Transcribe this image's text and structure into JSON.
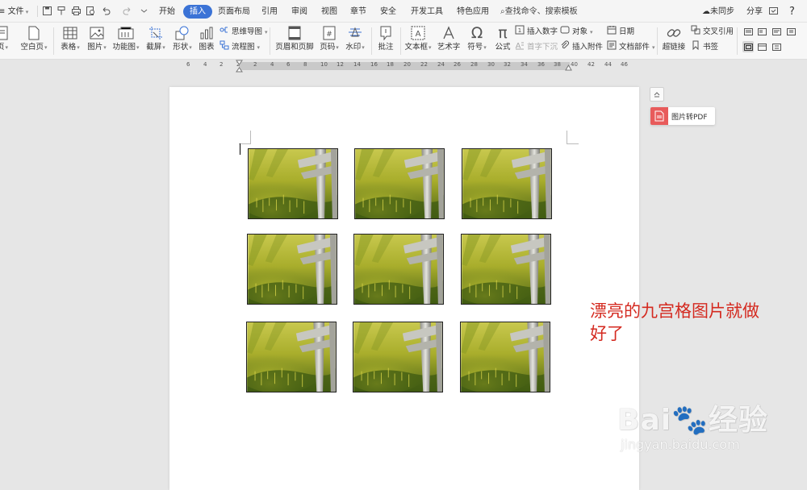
{
  "menubar": {
    "file_label": "文件",
    "tabs": [
      "开始",
      "插入",
      "页面布局",
      "引用",
      "审阅",
      "视图",
      "章节",
      "安全",
      "开发工具",
      "特色应用"
    ],
    "active_tab": "插入",
    "search_hint": "查找命令、搜索模板",
    "sync_status": "未同步",
    "share_label": "分享",
    "help_label": "?"
  },
  "ribbon": {
    "left_items": [
      {
        "label": "页",
        "caret": true,
        "icon": "page-icon"
      },
      {
        "label": "空白页",
        "caret": true,
        "icon": "blank-page-icon"
      },
      {
        "label": "表格",
        "caret": true,
        "icon": "table-icon"
      },
      {
        "label": "图片",
        "caret": true,
        "icon": "picture-icon"
      },
      {
        "label": "功能图",
        "caret": true,
        "icon": "function-chart-icon"
      },
      {
        "label": "截屏",
        "caret": true,
        "icon": "screenshot-icon"
      },
      {
        "label": "形状",
        "caret": true,
        "icon": "shape-icon"
      },
      {
        "label": "图表",
        "caret": false,
        "icon": "chart-icon"
      }
    ],
    "mindmap_label": "思维导图",
    "flowchart_label": "流程图",
    "mid_items": [
      {
        "label": "页眉和页脚",
        "caret": false,
        "icon": "header-footer-icon"
      },
      {
        "label": "页码",
        "caret": true,
        "icon": "page-number-icon"
      },
      {
        "label": "水印",
        "caret": true,
        "icon": "watermark-icon"
      },
      {
        "label": "批注",
        "caret": false,
        "icon": "comment-icon"
      },
      {
        "label": "文本框",
        "caret": true,
        "icon": "textbox-icon"
      },
      {
        "label": "艺术字",
        "caret": false,
        "icon": "wordart-icon"
      },
      {
        "label": "符号",
        "caret": true,
        "icon": "symbol-icon"
      },
      {
        "label": "公式",
        "caret": false,
        "icon": "formula-icon"
      }
    ],
    "insert_number": "插入数字",
    "drop_cap": "首字下沉",
    "object_label": "对象",
    "attachment_label": "插入附件",
    "date_label": "日期",
    "doc_parts_label": "文档部件",
    "hyperlink_label": "超链接",
    "cross_ref_label": "交叉引用",
    "bookmark_label": "书签"
  },
  "ruler": {
    "labels": [
      "6",
      "4",
      "2",
      "2",
      "2",
      "4",
      "6",
      "8",
      "10",
      "12",
      "14",
      "16",
      "18",
      "20",
      "22",
      "24",
      "26",
      "28",
      "30",
      "32",
      "34",
      "36",
      "38",
      "40",
      "42",
      "44",
      "46"
    ]
  },
  "side": {
    "pdf_label": "图片转PDF"
  },
  "annotation": "漂亮的九宫格图片就做好了",
  "watermark": {
    "logo": "Bai🐾经验",
    "url": "jingyan.baidu.com"
  },
  "colors": {
    "active_tab": "#3b73d6",
    "annotation": "#d42a20",
    "pdf_icon": "#e85b5b"
  },
  "photo_count": 9
}
